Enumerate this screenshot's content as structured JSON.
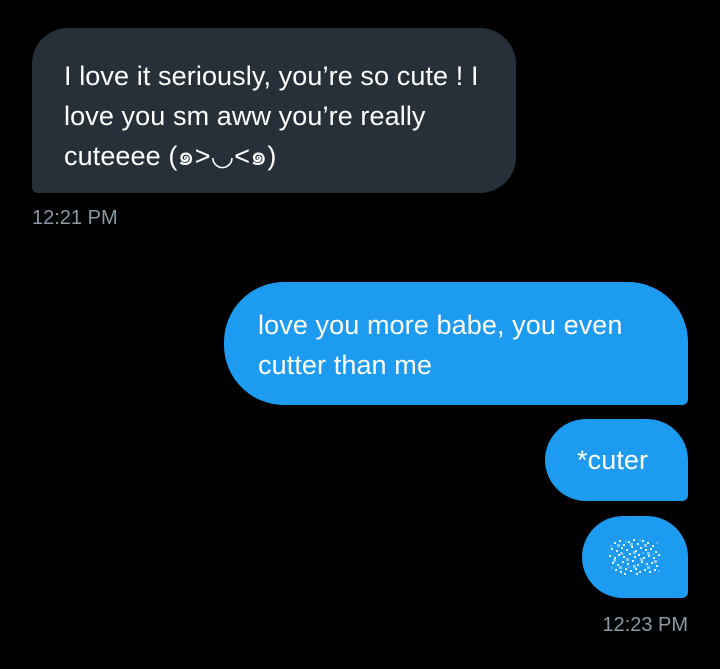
{
  "messages": [
    {
      "direction": "incoming",
      "text": "I love it seriously, you’re so cute ! I love you sm aww you’re really cuteeee (๑>◡<๑)"
    },
    {
      "direction": "outgoing",
      "text": "love you more babe, you even cutter than me"
    },
    {
      "direction": "outgoing",
      "text": "*cuter"
    },
    {
      "direction": "outgoing",
      "content": "obscured-emoji-icon"
    }
  ],
  "timestamps": {
    "incoming": "12:21 PM",
    "outgoing": "12:23 PM"
  },
  "colors": {
    "background": "#000000",
    "incoming_bubble": "#273039",
    "outgoing_bubble": "#1d9bf0",
    "timestamp": "#8b98a5",
    "text": "#ffffff"
  }
}
